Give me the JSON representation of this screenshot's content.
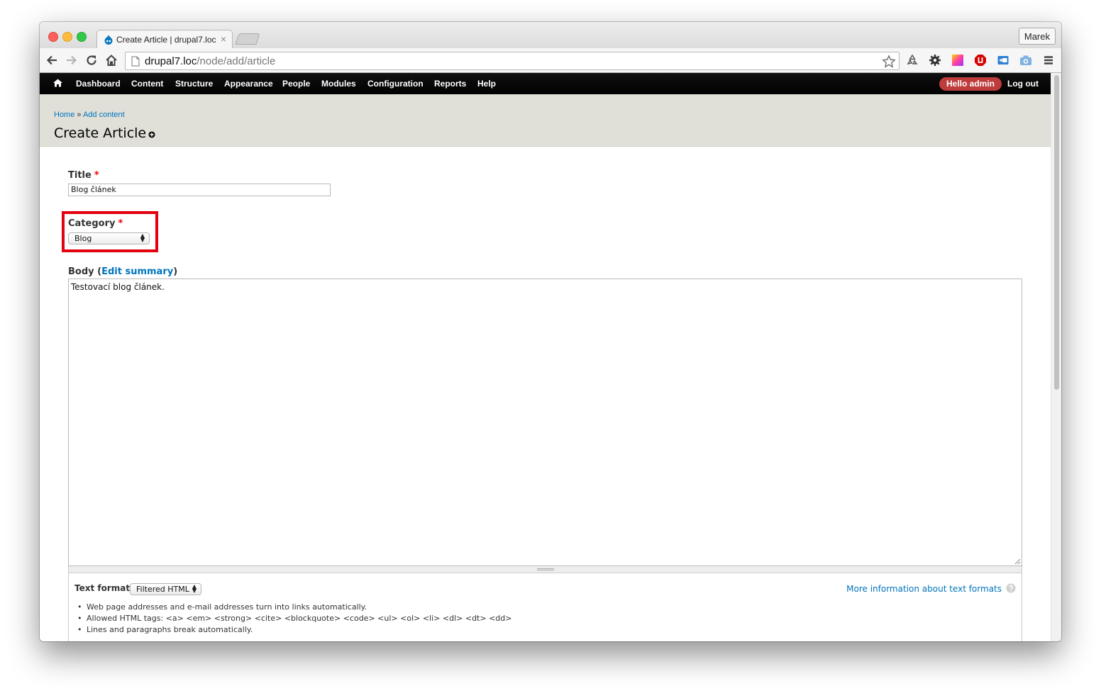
{
  "browser": {
    "tab_title": "Create Article | drupal7.loc",
    "tab_close": "×",
    "profile_name": "Marek",
    "url_host": "drupal7.loc",
    "url_path": "/node/add/article"
  },
  "admin_menu": {
    "items": [
      {
        "label": "Dashboard"
      },
      {
        "label": "Content"
      },
      {
        "label": "Structure"
      },
      {
        "label": "Appearance"
      },
      {
        "label": "People"
      },
      {
        "label": "Modules"
      },
      {
        "label": "Configuration"
      },
      {
        "label": "Reports"
      },
      {
        "label": "Help"
      }
    ],
    "hello": "Hello admin",
    "logout": "Log out"
  },
  "header": {
    "breadcrumb": {
      "home": "Home",
      "separator": " » ",
      "add_content": "Add content"
    },
    "title": "Create Article"
  },
  "form": {
    "title": {
      "label": "Title",
      "required_mark": "*",
      "value": "Blog článek"
    },
    "category": {
      "label": "Category",
      "required_mark": "*",
      "selected": "Blog"
    },
    "body": {
      "label": "Body",
      "paren_open": " (",
      "edit_summary": "Edit summary",
      "paren_close": ")",
      "value": "Testovací blog článek."
    },
    "text_format": {
      "label": "Text format",
      "selected": "Filtered HTML",
      "more_info": "More information about text formats",
      "tips": [
        "Web page addresses and e-mail addresses turn into links automatically.",
        "Allowed HTML tags: <a> <em> <strong> <cite> <blockquote> <code> <ul> <ol> <li> <dl> <dt> <dd>",
        "Lines and paragraphs break automatically."
      ]
    }
  },
  "colors": {
    "admin_bar": "#000000",
    "hello_badge": "#bf3c3c",
    "link": "#0074bd",
    "header_bg": "#e0e0d8",
    "highlight": "#e3000f",
    "required": "#ee0000"
  }
}
